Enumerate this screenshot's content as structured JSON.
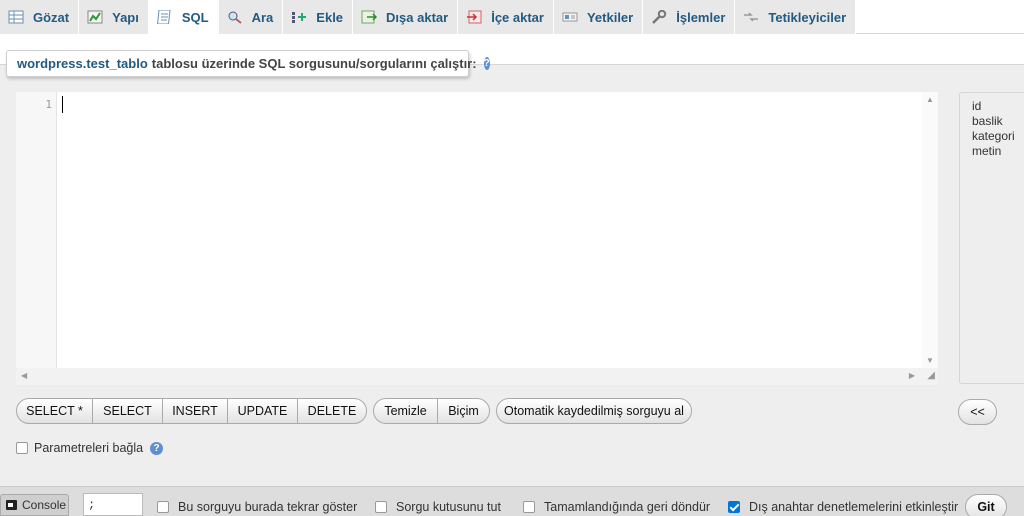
{
  "tabs": [
    {
      "label": "Gözat",
      "icon": "browse-icon"
    },
    {
      "label": "Yapı",
      "icon": "structure-icon"
    },
    {
      "label": "SQL",
      "icon": "sql-icon"
    },
    {
      "label": "Ara",
      "icon": "search-icon"
    },
    {
      "label": "Ekle",
      "icon": "insert-icon"
    },
    {
      "label": "Dışa aktar",
      "icon": "export-icon"
    },
    {
      "label": "İçe aktar",
      "icon": "import-icon"
    },
    {
      "label": "Yetkiler",
      "icon": "privileges-icon"
    },
    {
      "label": "İşlemler",
      "icon": "operations-icon"
    },
    {
      "label": "Tetikleyiciler",
      "icon": "triggers-icon"
    }
  ],
  "active_tab": "SQL",
  "legend": {
    "table": "wordpress.test_tablo",
    "text": "tablosu üzerinde SQL sorgusunu/sorgularını çalıştır:"
  },
  "editor": {
    "line_number": "1",
    "content": ""
  },
  "columns": [
    "id",
    "baslik",
    "kategori",
    "metin"
  ],
  "buttons": {
    "select_star": "SELECT *",
    "select": "SELECT",
    "insert": "INSERT",
    "update": "UPDATE",
    "delete": "DELETE",
    "clear": "Temizle",
    "format": "Biçim",
    "autosave": "Otomatik kaydedilmiş sorguyu al",
    "collapse": "<<",
    "go": "Git"
  },
  "bind_params": {
    "label": "Parametreleri bağla",
    "checked": false
  },
  "delimiter": ";",
  "options": [
    {
      "label": "Bu sorguyu burada tekrar göster",
      "checked": false
    },
    {
      "label": "Sorgu kutusunu tut",
      "checked": false
    },
    {
      "label": "Tamamlandığında geri döndür",
      "checked": false
    },
    {
      "label": "Dış anahtar denetlemelerini etkinleştir",
      "checked": true
    }
  ],
  "console_label": "Console",
  "colors": {
    "link": "#235a81",
    "checkbox_on": "#0075d9",
    "panel_bg": "#eeeeee"
  }
}
